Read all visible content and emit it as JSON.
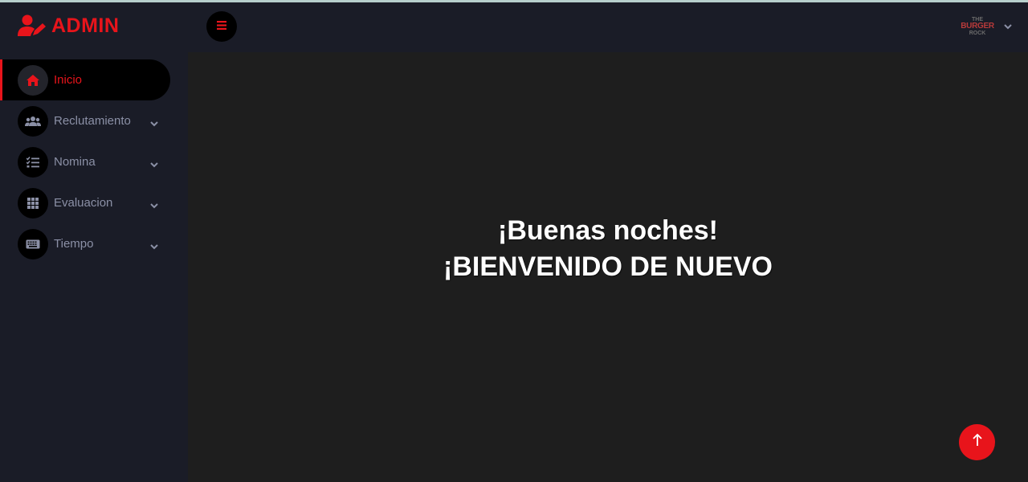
{
  "brand": {
    "title": "ADMIN",
    "icon": "user-edit-icon",
    "accent": "#e8141b"
  },
  "topbar": {
    "menu_toggle_icon": "bars-icon",
    "logo": {
      "line1": "THE",
      "line2": "BURGER",
      "line3": "ROCK"
    },
    "dropdown_icon": "chevron-down-icon"
  },
  "sidebar": {
    "items": [
      {
        "label": "Inicio",
        "icon": "home-icon",
        "active": true,
        "has_submenu": false
      },
      {
        "label": "Reclutamiento",
        "icon": "users-icon",
        "active": false,
        "has_submenu": true
      },
      {
        "label": "Nomina",
        "icon": "tasks-icon",
        "active": false,
        "has_submenu": true
      },
      {
        "label": "Evaluacion",
        "icon": "grid-icon",
        "active": false,
        "has_submenu": true
      },
      {
        "label": "Tiempo",
        "icon": "keyboard-icon",
        "active": false,
        "has_submenu": true
      }
    ]
  },
  "main": {
    "greeting": "¡Buenas noches!",
    "welcome": "¡BIENVENIDO DE NUEVO"
  },
  "scroll_top": {
    "icon": "arrow-up-icon"
  },
  "colors": {
    "sidebar_bg": "#1a1c27",
    "content_bg": "#1e1e1e",
    "muted_text": "#8b90a6"
  }
}
